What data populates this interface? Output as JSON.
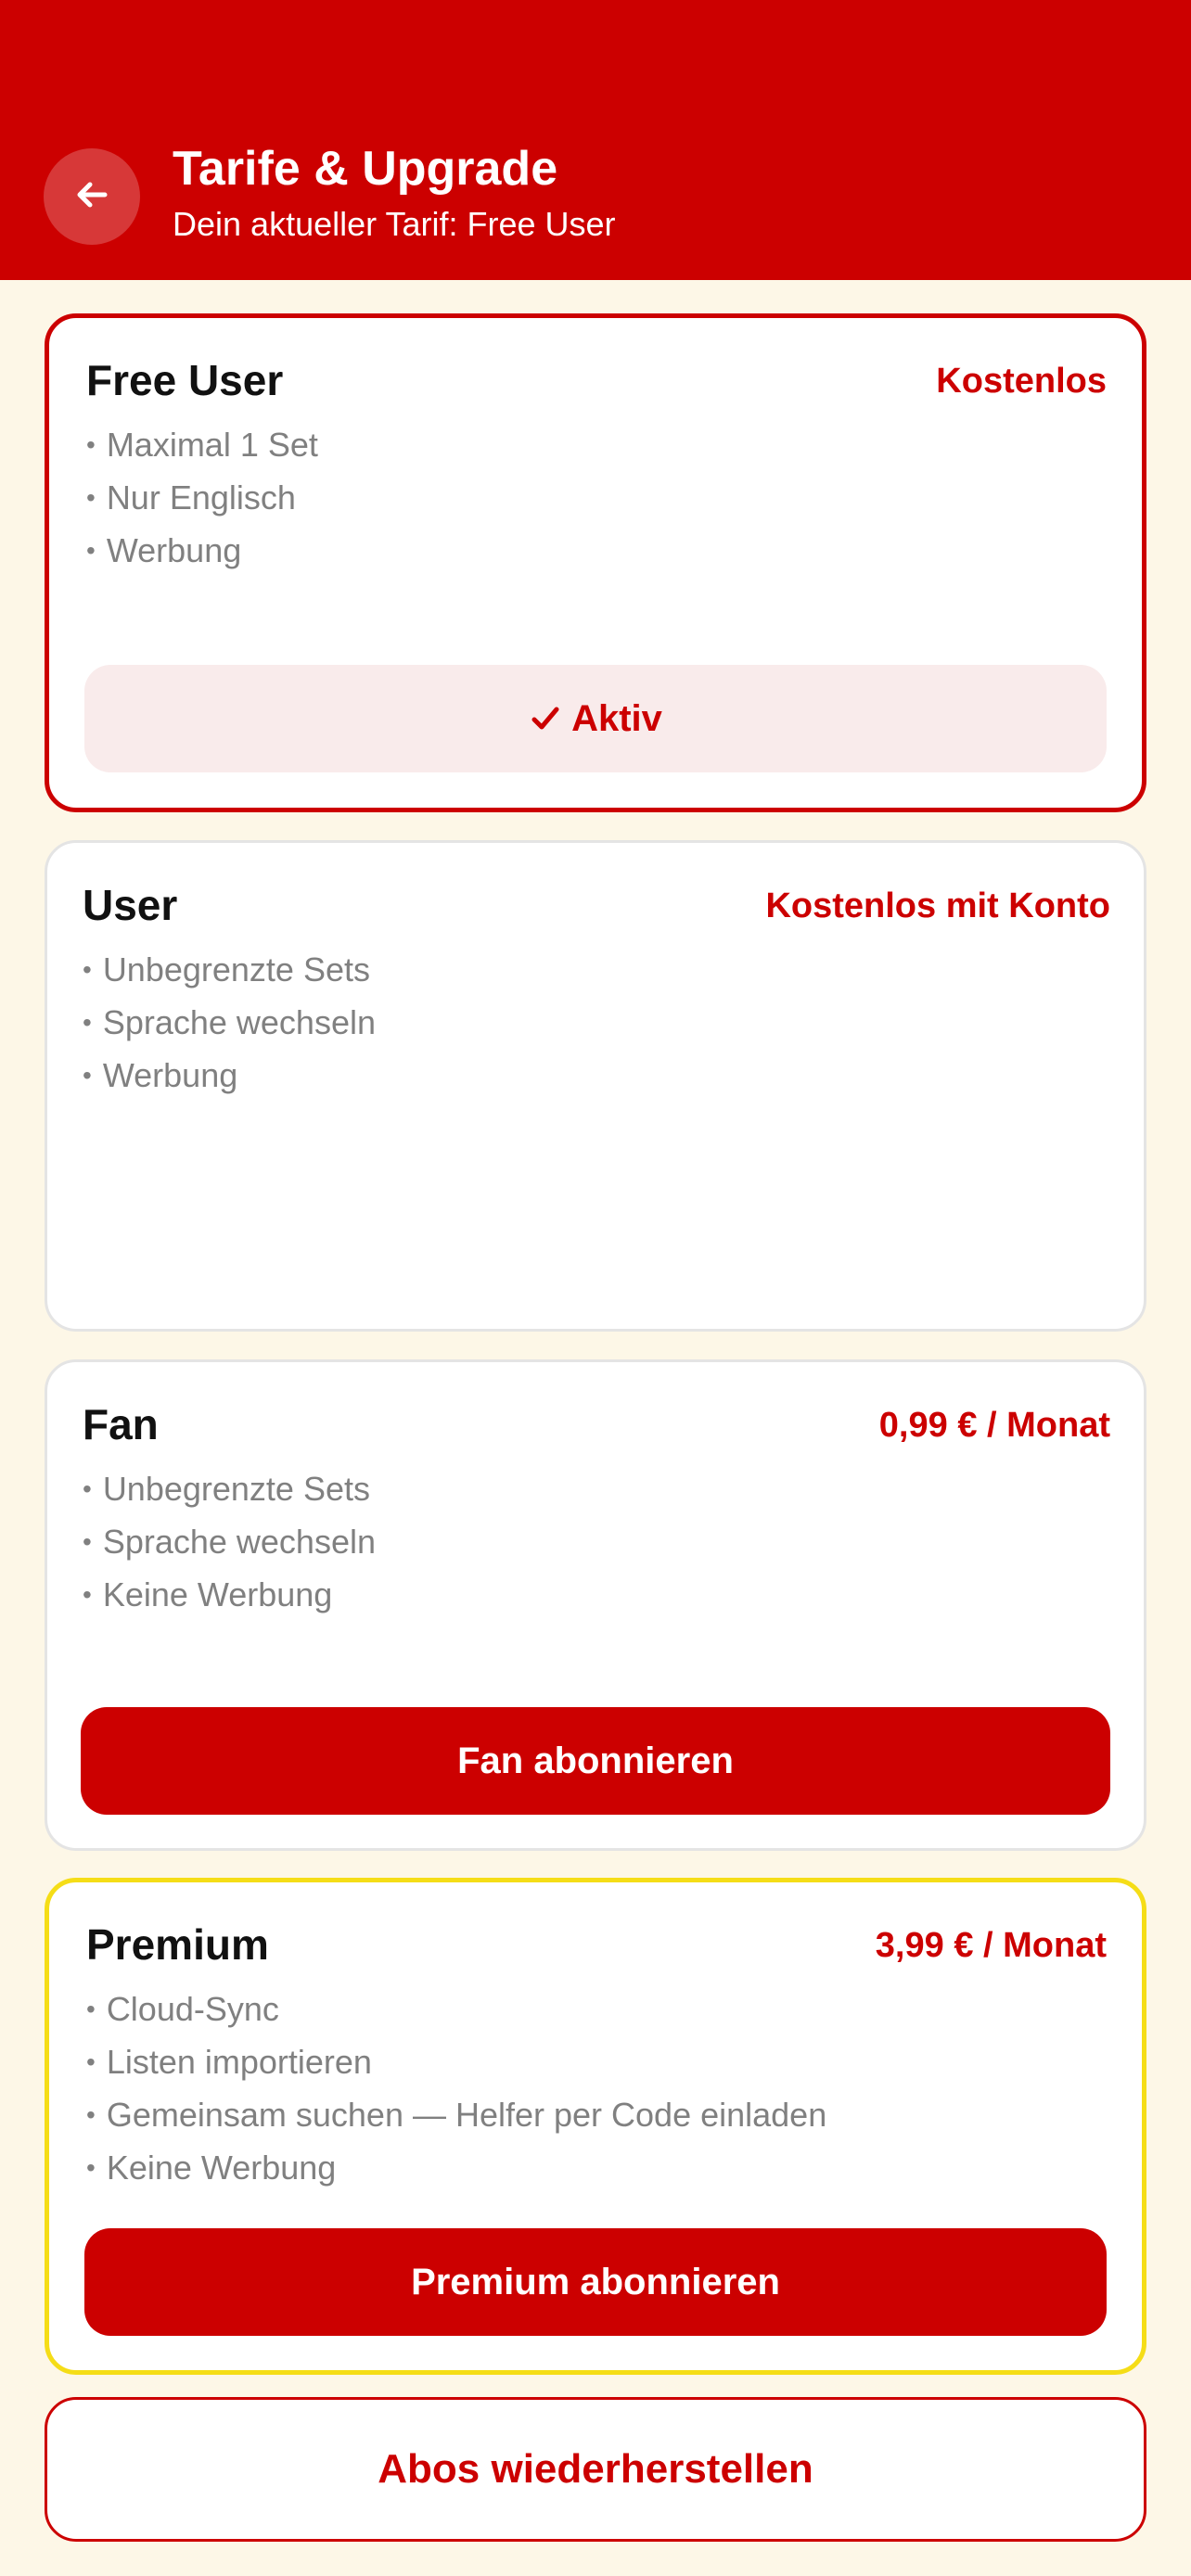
{
  "header": {
    "title": "Tarife & Upgrade",
    "subtitle": "Dein aktueller Tarif: Free User",
    "back_icon": "arrow-left-icon"
  },
  "plans": [
    {
      "name": "Free User",
      "price": "Kostenlos",
      "features": [
        "Maximal 1 Set",
        "Nur Englisch",
        "Werbung"
      ],
      "status_label": "Aktiv",
      "status_icon": "checkmark-icon"
    },
    {
      "name": "User",
      "price": "Kostenlos mit Konto",
      "features": [
        "Unbegrenzte Sets",
        "Sprache wechseln",
        "Werbung"
      ]
    },
    {
      "name": "Fan",
      "price": "0,99 € / Monat",
      "features": [
        "Unbegrenzte Sets",
        "Sprache wechseln",
        "Keine Werbung"
      ],
      "cta_label": "Fan abonnieren"
    },
    {
      "name": "Premium",
      "price": "3,99 € / Monat",
      "features": [
        "Cloud-Sync",
        "Listen importieren",
        "Gemeinsam suchen — Helfer per Code einladen",
        "Keine Werbung"
      ],
      "cta_label": "Premium abonnieren"
    }
  ],
  "restore_label": "Abos wiederherstellen",
  "colors": {
    "brand": "#cc0000",
    "background": "#fdf7e7",
    "premium_border": "#f5dd17",
    "active_bg": "#f9ebeb",
    "feature_text": "#808080"
  }
}
